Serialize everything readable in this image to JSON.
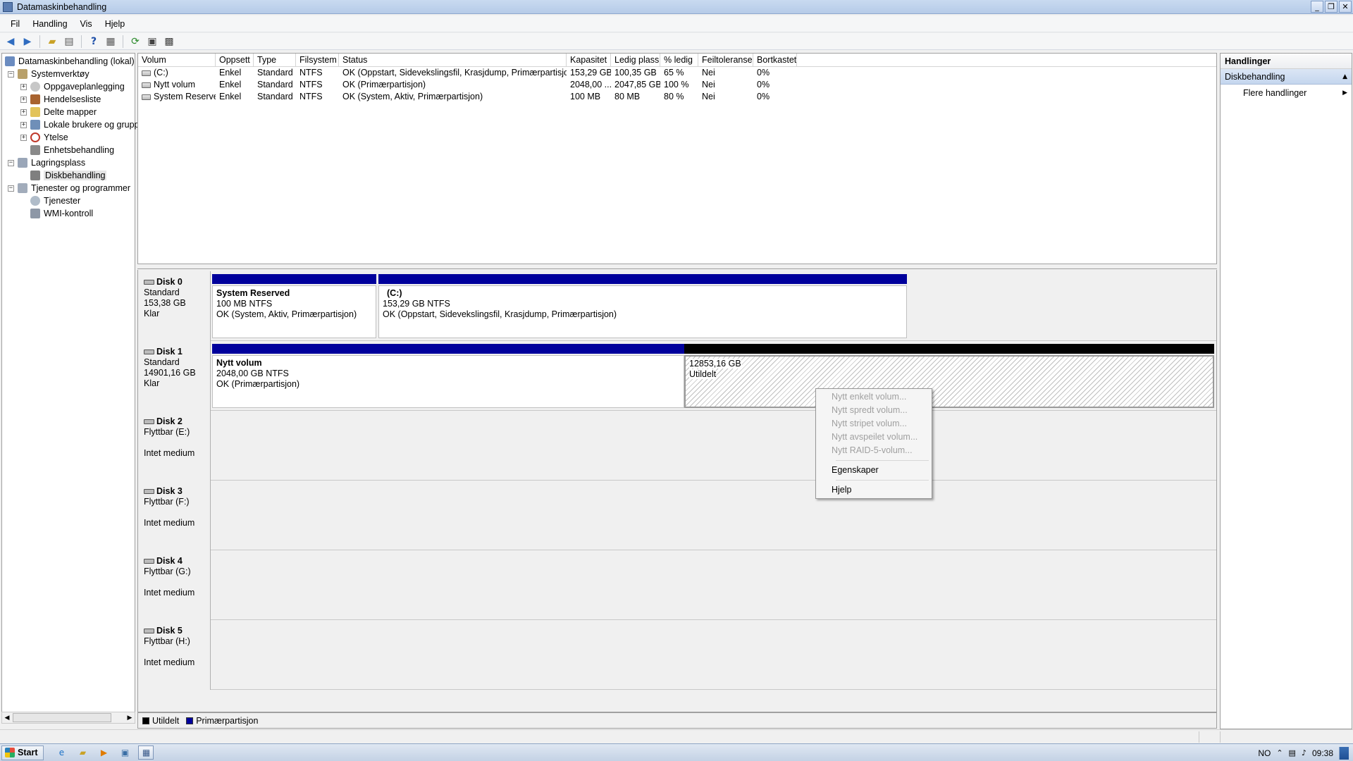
{
  "window": {
    "title": "Datamaskinbehandling",
    "controls": [
      "_",
      "❐",
      "✕"
    ]
  },
  "menu": [
    "Fil",
    "Handling",
    "Vis",
    "Hjelp"
  ],
  "toolbar": [
    "back-icon",
    "forward-icon",
    "up-folder-icon",
    "show-hide-tree-icon",
    "help-icon",
    "properties-view-icon",
    "refresh-icon",
    "properties-icon",
    "settings-icon"
  ],
  "tree": {
    "root": "Datamaskinbehandling (lokal)",
    "items": [
      {
        "label": "Systemverktøy",
        "level": 1,
        "expander": "−",
        "icon": "tools-icon"
      },
      {
        "label": "Oppgaveplanlegging",
        "level": 2,
        "expander": "+",
        "icon": "clock-icon"
      },
      {
        "label": "Hendelsesliste",
        "level": 2,
        "expander": "+",
        "icon": "event-viewer-icon"
      },
      {
        "label": "Delte mapper",
        "level": 2,
        "expander": "+",
        "icon": "shared-folder-icon"
      },
      {
        "label": "Lokale brukere og grupp",
        "level": 2,
        "expander": "+",
        "icon": "users-icon"
      },
      {
        "label": "Ytelse",
        "level": 2,
        "expander": "+",
        "icon": "performance-icon"
      },
      {
        "label": "Enhetsbehandling",
        "level": 2,
        "expander": "",
        "icon": "device-manager-icon"
      },
      {
        "label": "Lagringsplass",
        "level": 1,
        "expander": "−",
        "icon": "storage-icon"
      },
      {
        "label": "Diskbehandling",
        "level": 2,
        "expander": "",
        "icon": "disk-management-icon",
        "selected": true
      },
      {
        "label": "Tjenester og programmer",
        "level": 1,
        "expander": "−",
        "icon": "services-apps-icon"
      },
      {
        "label": "Tjenester",
        "level": 2,
        "expander": "",
        "icon": "services-icon"
      },
      {
        "label": "WMI-kontroll",
        "level": 2,
        "expander": "",
        "icon": "wmi-icon"
      }
    ]
  },
  "volumes": {
    "columns": [
      "Volum",
      "Oppsett",
      "Type",
      "Filsystem",
      "Status",
      "Kapasitet",
      "Ledig plass",
      "% ledig",
      "Feiltoleranse",
      "Bortkastet"
    ],
    "rows": [
      [
        "(C:)",
        "Enkel",
        "Standard",
        "NTFS",
        "OK (Oppstart, Sidevekslingsfil, Krasjdump, Primærpartisjon)",
        "153,29 GB",
        "100,35 GB",
        "65 %",
        "Nei",
        "0%"
      ],
      [
        "Nytt volum",
        "Enkel",
        "Standard",
        "NTFS",
        "OK (Primærpartisjon)",
        "2048,00 ...",
        "2047,85 GB",
        "100 %",
        "Nei",
        "0%"
      ],
      [
        "System Reserved",
        "Enkel",
        "Standard",
        "NTFS",
        "OK (System, Aktiv, Primærpartisjon)",
        "100 MB",
        "80 MB",
        "80 %",
        "Nei",
        "0%"
      ]
    ]
  },
  "disks": [
    {
      "name": "Disk 0",
      "type": "Standard",
      "size": "153,38 GB",
      "status": "Klar",
      "partitions": [
        {
          "name": "System Reserved",
          "size": "100 MB NTFS",
          "status": "OK (System, Aktiv, Primærpartisjon)",
          "kind": "primary"
        },
        {
          "name": "(C:)",
          "size": "153,29 GB NTFS",
          "status": "OK (Oppstart, Sidevekslingsfil, Krasjdump, Primærpartisjon)",
          "kind": "primary"
        }
      ]
    },
    {
      "name": "Disk 1",
      "type": "Standard",
      "size": "14901,16 GB",
      "status": "Klar",
      "partitions": [
        {
          "name": "Nytt volum",
          "size": "2048,00 GB NTFS",
          "status": "OK (Primærpartisjon)",
          "kind": "primary"
        },
        {
          "name": "",
          "size": "12853,16 GB",
          "status": "Utildelt",
          "kind": "unallocated"
        }
      ]
    },
    {
      "name": "Disk 2",
      "type": "Flyttbar (E:)",
      "status": "Intet medium"
    },
    {
      "name": "Disk 3",
      "type": "Flyttbar (F:)",
      "status": "Intet medium"
    },
    {
      "name": "Disk 4",
      "type": "Flyttbar (G:)",
      "status": "Intet medium"
    },
    {
      "name": "Disk 5",
      "type": "Flyttbar (H:)",
      "status": "Intet medium"
    }
  ],
  "legend": [
    {
      "label": "Utildelt",
      "color": "#000000"
    },
    {
      "label": "Primærpartisjon",
      "color": "#00009c"
    }
  ],
  "actions": {
    "title": "Handlinger",
    "section": "Diskbehandling",
    "items": [
      "Flere handlinger"
    ]
  },
  "context_menu": {
    "items": [
      {
        "label": "Nytt enkelt volum...",
        "enabled": false
      },
      {
        "label": "Nytt spredt volum...",
        "enabled": false
      },
      {
        "label": "Nytt stripet volum...",
        "enabled": false
      },
      {
        "label": "Nytt avspeilet volum...",
        "enabled": false
      },
      {
        "label": "Nytt RAID-5-volum...",
        "enabled": false
      },
      {
        "label": "Egenskaper",
        "enabled": true
      },
      {
        "label": "Hjelp",
        "enabled": true
      }
    ]
  },
  "taskbar": {
    "start": "Start",
    "apps": [
      "internet-explorer-icon",
      "explorer-icon",
      "media-player-icon",
      "remote-desktop-icon",
      "computer-management-icon"
    ],
    "lang": "NO",
    "clock": "09:38"
  },
  "colors": {
    "primary_partition": "#00009c",
    "unallocated": "#000000",
    "titlebar": "#c9daf0"
  }
}
